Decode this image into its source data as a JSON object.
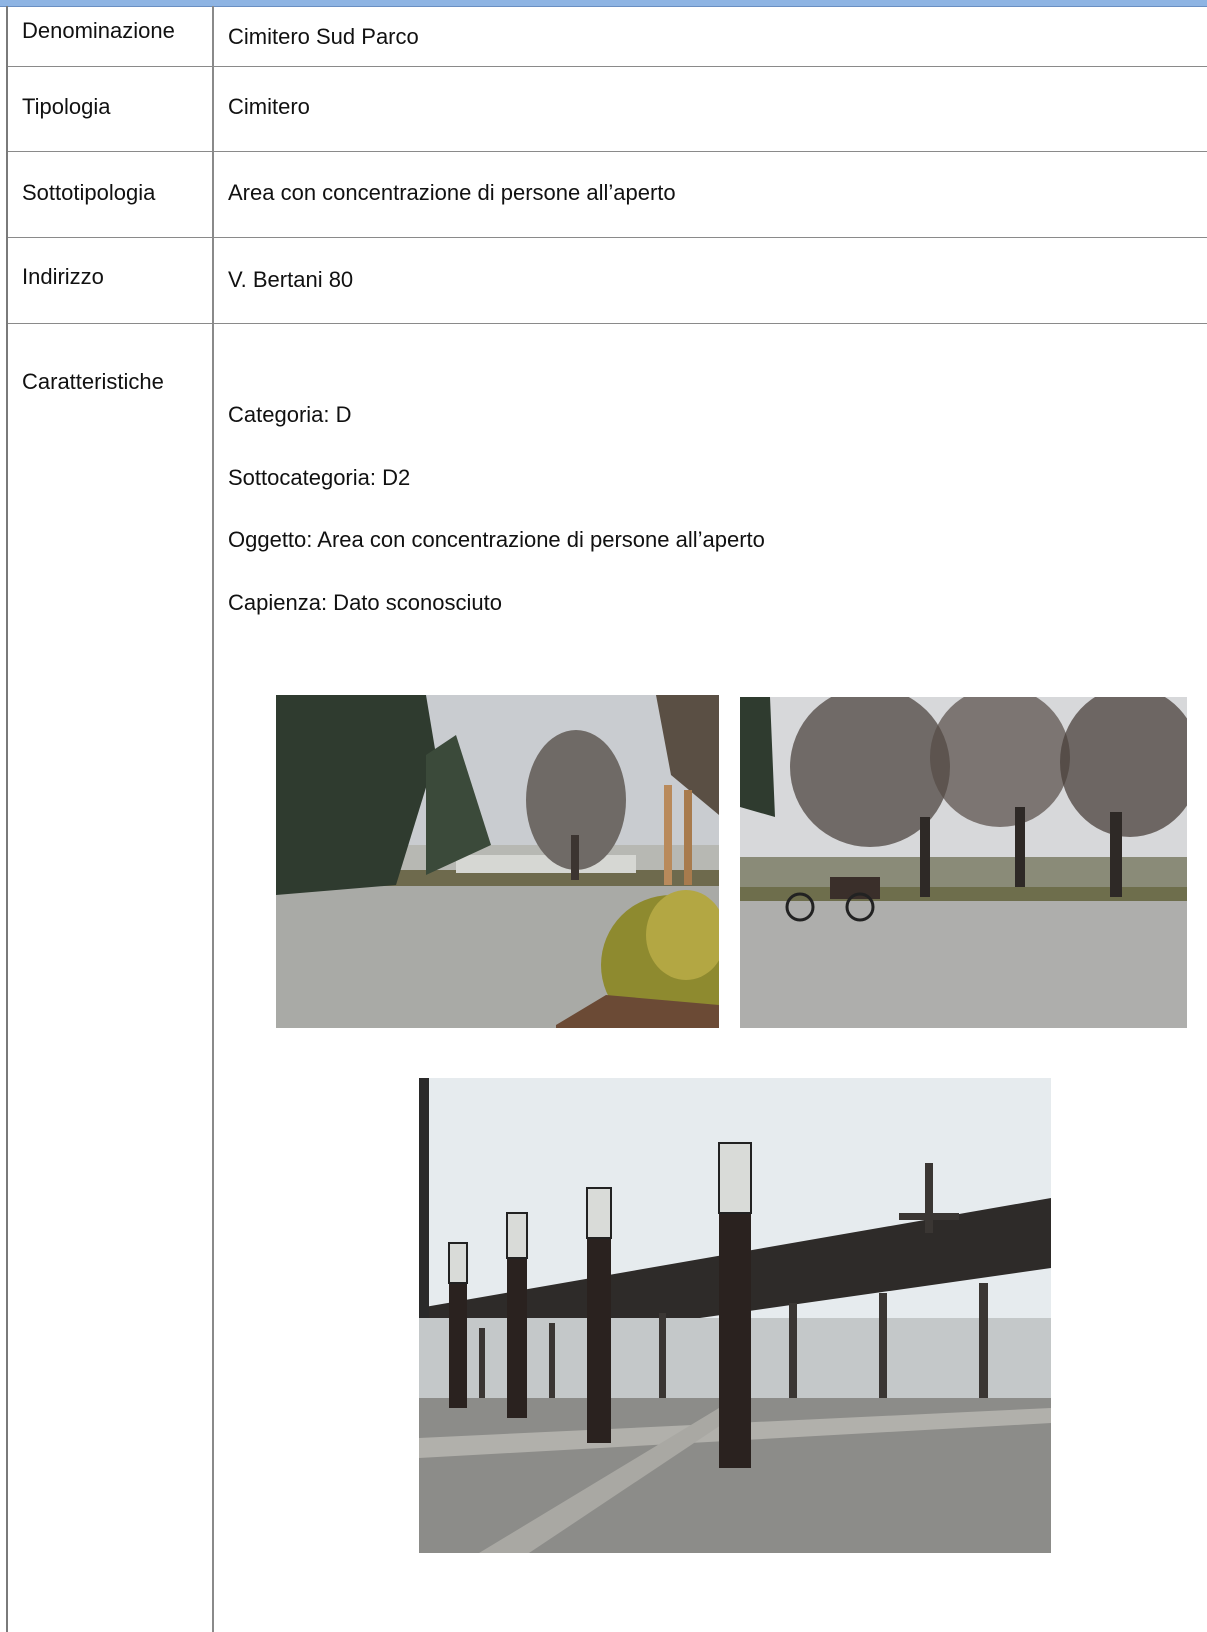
{
  "rows": [
    {
      "label": "Denominazione",
      "value": "Cimitero Sud Parco"
    },
    {
      "label": "Tipologia",
      "value": "Cimitero"
    },
    {
      "label": "Sottotipologia",
      "value": "Area con concentrazione di persone all’aperto"
    },
    {
      "label": "Indirizzo",
      "value": "V. Bertani 80"
    }
  ],
  "caratteristiche": {
    "label": "Caratteristiche",
    "lines": [
      "Categoria: D",
      "Sottocategoria: D2",
      "Oggetto: Area con concentrazione di persone all’aperto",
      "Capienza: Dato sconosciuto"
    ]
  }
}
